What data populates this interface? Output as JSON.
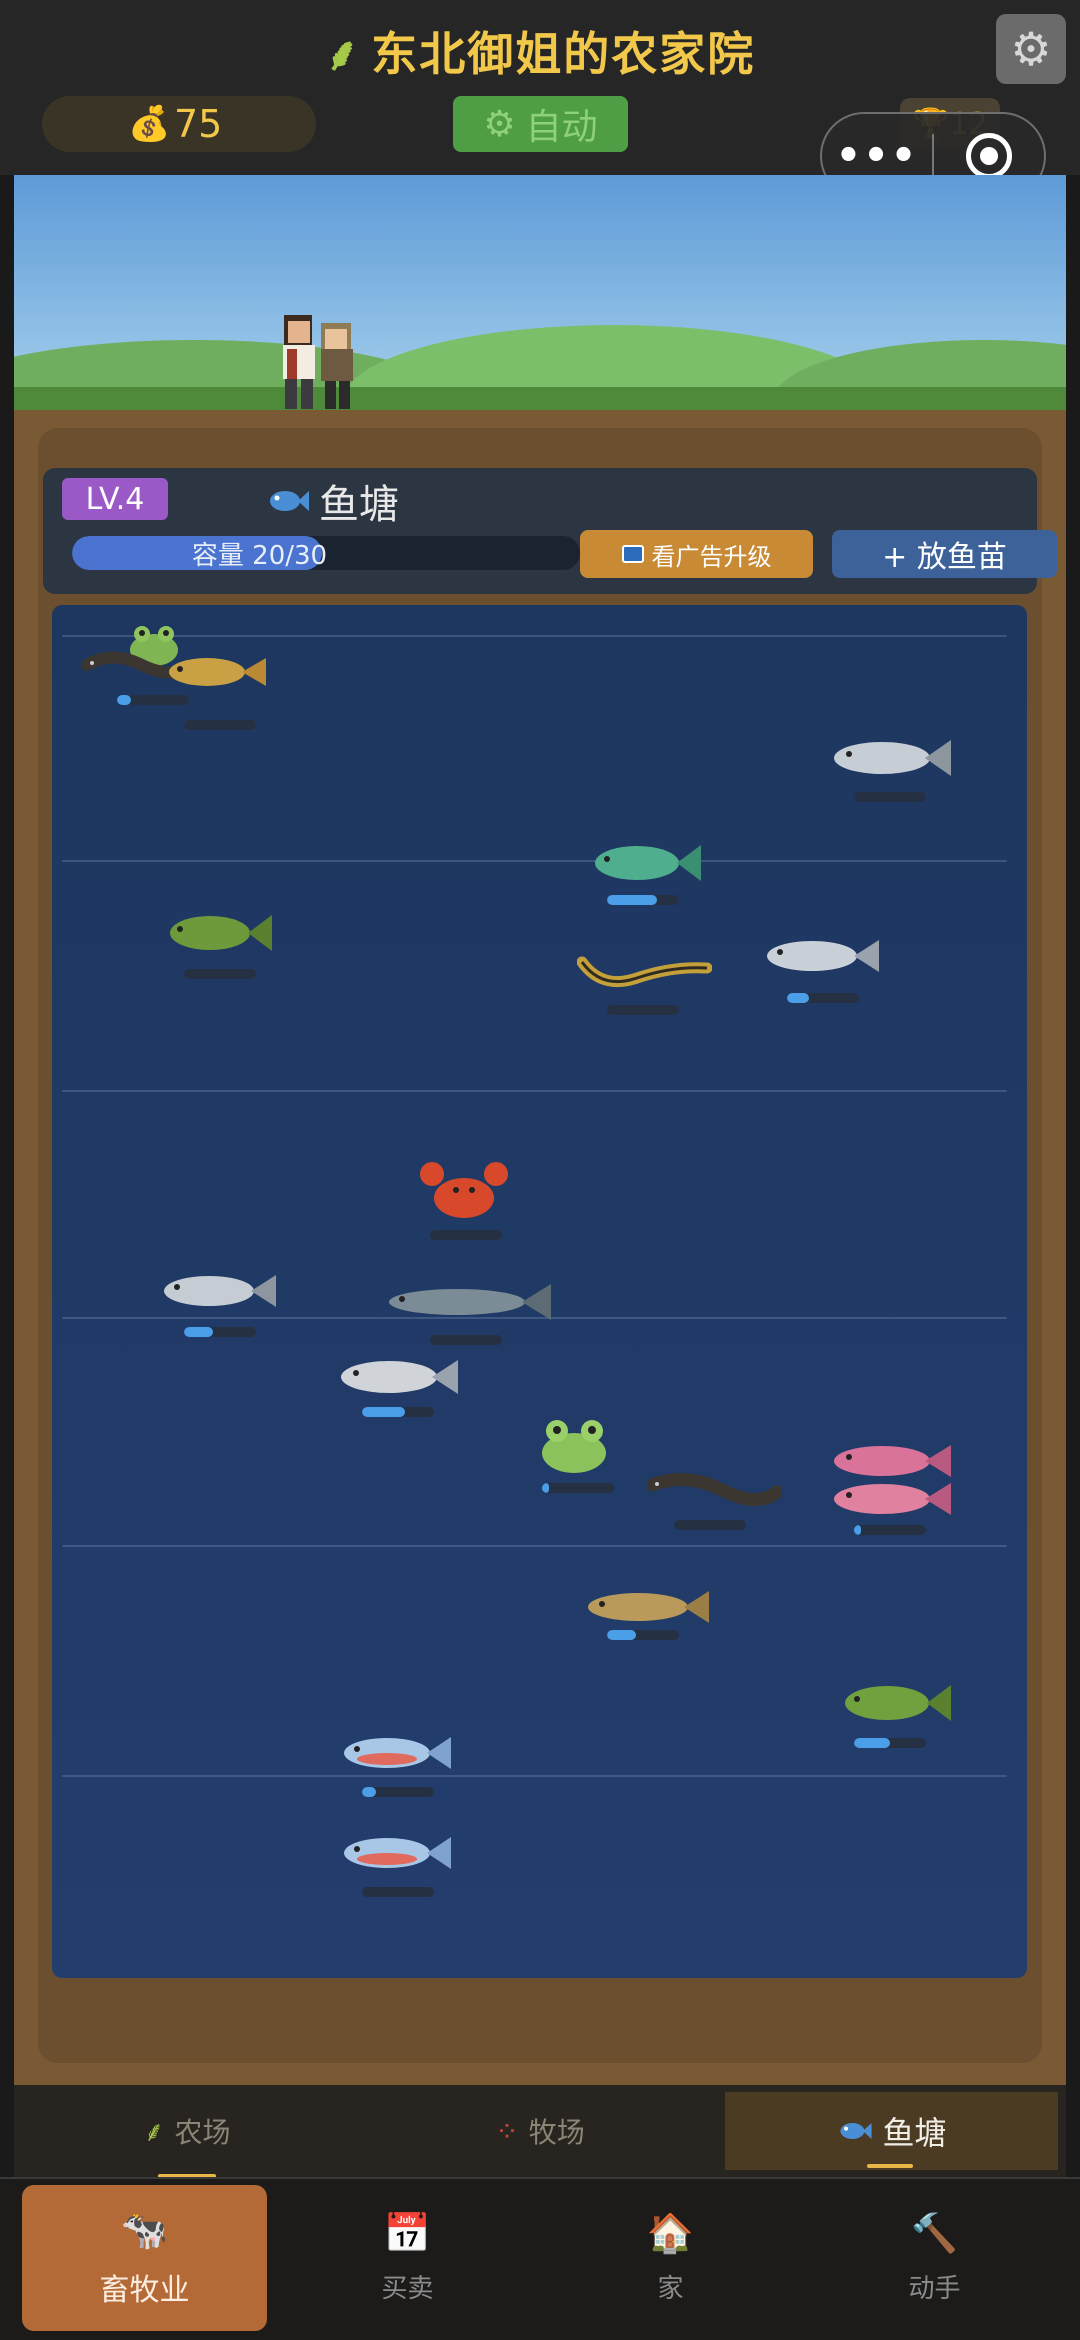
{
  "header": {
    "title": "东北御姐的农家院",
    "coins": "75",
    "auto_label": "自动",
    "trophy_count": "12",
    "settings_icon": "gear-icon"
  },
  "pond": {
    "level": "LV.4",
    "title": "鱼塘",
    "capacity_label": "容量 20/30",
    "capacity_current": 20,
    "capacity_max": 30,
    "ad_upgrade_label": "看广告升级",
    "add_fry_label": "+ 放鱼苗"
  },
  "creatures": [
    {
      "type": "frog",
      "progress": 0.0
    },
    {
      "type": "eel",
      "progress": 0.2
    },
    {
      "type": "carp",
      "progress": 0.0
    },
    {
      "type": "silver-fish",
      "progress": 0.0
    },
    {
      "type": "green-fish",
      "progress": 0.7
    },
    {
      "type": "bass",
      "progress": 0.0
    },
    {
      "type": "yellow-eel",
      "progress": 0.0
    },
    {
      "type": "silver-fish",
      "progress": 0.3
    },
    {
      "type": "crab",
      "progress": 0.0
    },
    {
      "type": "silver-fish",
      "progress": 0.4
    },
    {
      "type": "sturgeon",
      "progress": 0.0
    },
    {
      "type": "silver-fish",
      "progress": 0.6
    },
    {
      "type": "frog",
      "progress": 0.1
    },
    {
      "type": "eel",
      "progress": 0.0
    },
    {
      "type": "pink-fish",
      "progress": 0.0
    },
    {
      "type": "pink-fish",
      "progress": 0.1
    },
    {
      "type": "carp",
      "progress": 0.4
    },
    {
      "type": "bass",
      "progress": 0.5
    },
    {
      "type": "blue-fish",
      "progress": 0.2
    },
    {
      "type": "blue-fish",
      "progress": 0.0
    }
  ],
  "subtabs": {
    "farm": "农场",
    "ranch": "牧场",
    "pond": "鱼塘"
  },
  "bottomnav": {
    "livestock": "畜牧业",
    "trade": "买卖",
    "home": "家",
    "craft": "动手"
  },
  "colors": {
    "accent_gold": "#f2c84b",
    "active_nav": "#b46a36",
    "water": "#1e3760"
  }
}
